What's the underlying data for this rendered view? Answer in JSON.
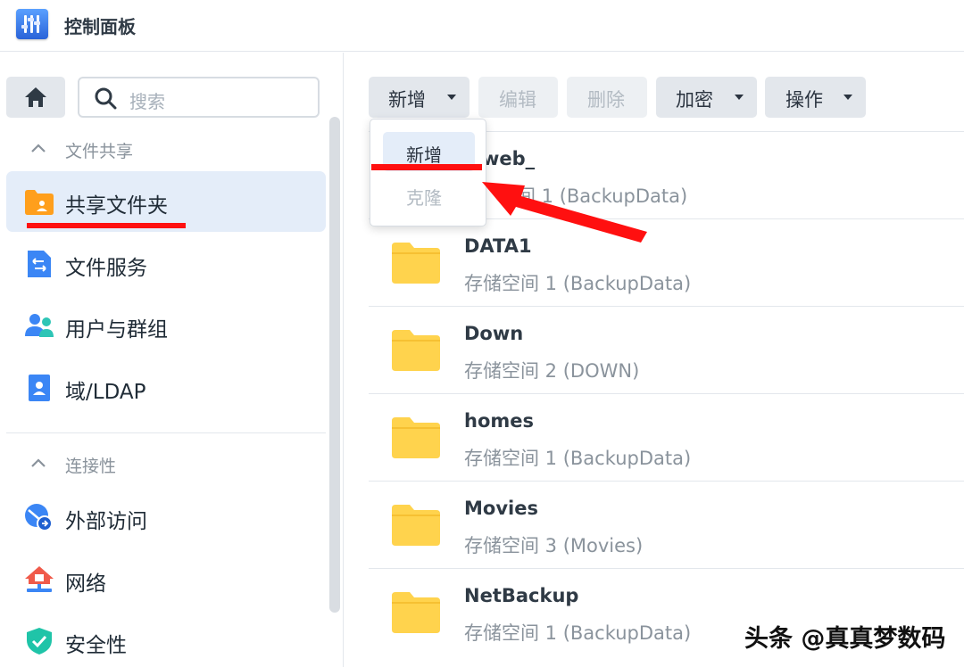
{
  "window": {
    "title": "控制面板",
    "icon": "control-panel-icon"
  },
  "sidebar": {
    "search_placeholder": "搜索",
    "sections": [
      {
        "label": "文件共享",
        "items": [
          {
            "label": "共享文件夹",
            "icon": "shared-folder-icon",
            "active": true
          },
          {
            "label": "文件服务",
            "icon": "file-services-icon"
          },
          {
            "label": "用户与群组",
            "icon": "users-groups-icon"
          },
          {
            "label": "域/LDAP",
            "icon": "domain-ldap-icon"
          }
        ]
      },
      {
        "label": "连接性",
        "items": [
          {
            "label": "外部访问",
            "icon": "external-access-icon"
          },
          {
            "label": "网络",
            "icon": "network-icon"
          },
          {
            "label": "安全性",
            "icon": "security-shield-icon"
          }
        ]
      }
    ]
  },
  "toolbar": {
    "create": "新增",
    "edit": "编辑",
    "delete": "删除",
    "encrypt": "加密",
    "action": "操作"
  },
  "create_menu": {
    "items": [
      "新增",
      "克隆"
    ]
  },
  "shared_folders": [
    {
      "name": "web_",
      "volume": "存储空间 1 (BackupData)"
    },
    {
      "name": "DATA1",
      "volume": "存储空间 1 (BackupData)"
    },
    {
      "name": "Down",
      "volume": "存储空间 2 (DOWN)"
    },
    {
      "name": "homes",
      "volume": "存储空间 1 (BackupData)"
    },
    {
      "name": "Movies",
      "volume": "存储空间 3 (Movies)"
    },
    {
      "name": "NetBackup",
      "volume": "存储空间 1 (BackupData)"
    }
  ],
  "visible_first_row": {
    "name_partial": "web_",
    "volume_partial": "间 1 (BackupData)"
  },
  "watermark": "头条 @真真梦数码",
  "colors": {
    "annotation": "#ff1010",
    "folder": "#ffd34d",
    "active_bg": "#e4edf9"
  }
}
